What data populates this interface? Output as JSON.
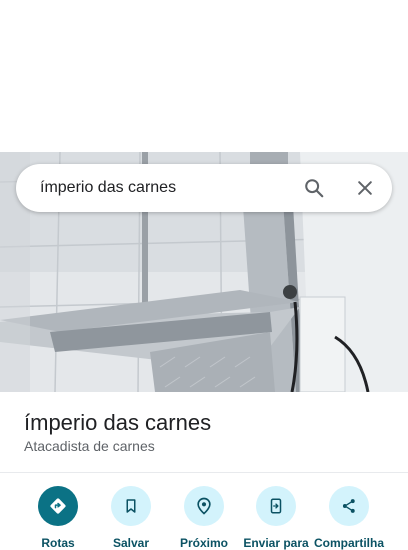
{
  "search": {
    "query": "ímperio das carnes",
    "search_icon": "search-icon",
    "close_icon": "close-icon"
  },
  "place": {
    "name": "ímperio das carnes",
    "category": "Atacadista de carnes"
  },
  "actions": [
    {
      "label": "Rotas",
      "icon": "directions-icon"
    },
    {
      "label": "Salvar",
      "icon": "bookmark-icon"
    },
    {
      "label": "Próximo",
      "icon": "nearby-icon"
    },
    {
      "label": "Enviar para",
      "icon": "send-to-phone-icon"
    },
    {
      "label": "Compartilha",
      "icon": "share-icon"
    }
  ],
  "colors": {
    "accent": "#0b7285",
    "accent_light": "#d3f3fc",
    "label": "#0b5263"
  }
}
